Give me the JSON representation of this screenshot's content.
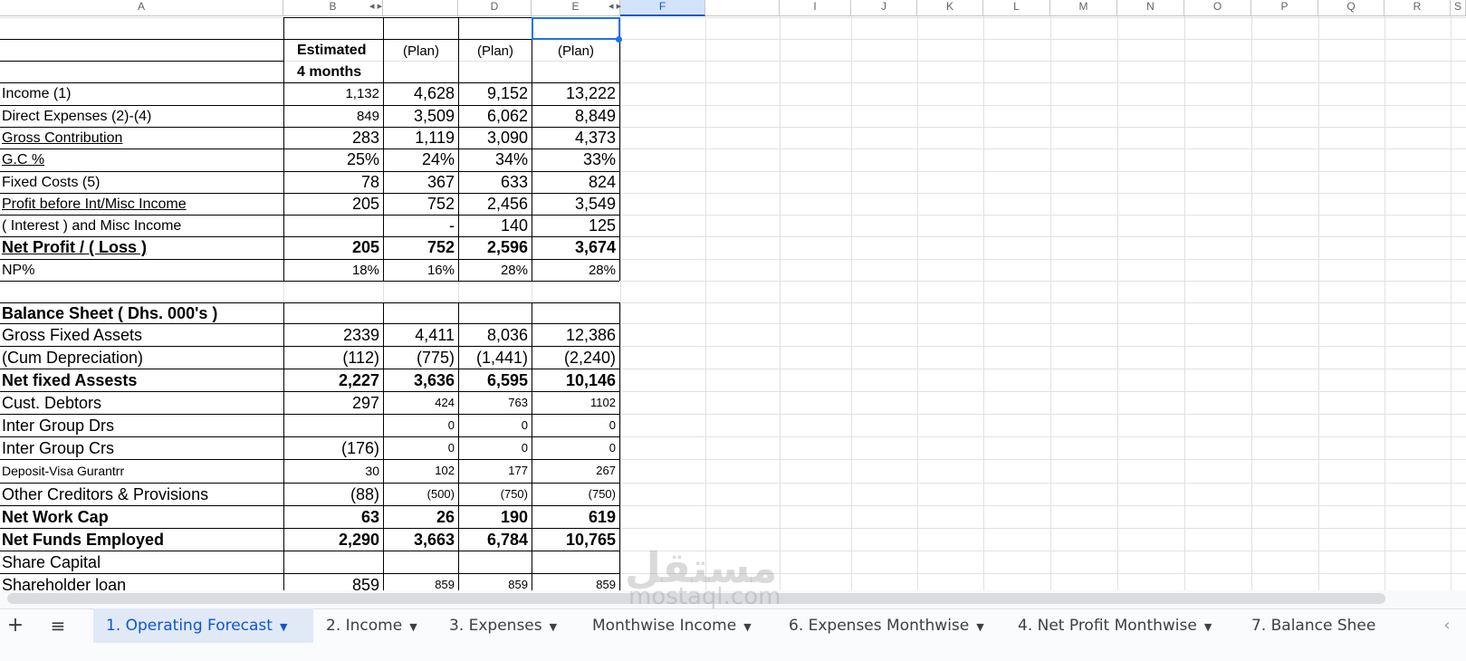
{
  "columns": [
    "A",
    "B",
    "",
    "D",
    "E",
    "F",
    "",
    "I",
    "J",
    "K",
    "L",
    "M",
    "N",
    "O",
    "P",
    "Q",
    "R",
    "S",
    ""
  ],
  "header_row": {
    "b1": "Estimated",
    "b2": "4 months",
    "d": "(Plan)",
    "e": "(Plan)",
    "f": "(Plan)"
  },
  "pl": [
    {
      "label": "Income (1)",
      "b": "1,132",
      "d": "4,628",
      "e": "9,152",
      "f": "13,222"
    },
    {
      "label": "Direct Expenses (2)-(4)",
      "b": "849",
      "d": "3,509",
      "e": "6,062",
      "f": "8,849"
    },
    {
      "label": "Gross Contribution",
      "b": "283",
      "d": "1,119",
      "e": "3,090",
      "f": "4,373"
    },
    {
      "label": "G.C %",
      "b": "25%",
      "d": "24%",
      "e": "34%",
      "f": "33%"
    },
    {
      "label": "Fixed Costs (5)",
      "b": "78",
      "d": "367",
      "e": "633",
      "f": "824"
    },
    {
      "label": "Profit before Int/Misc Income",
      "b": "205",
      "d": "752",
      "e": "2,456",
      "f": "3,549"
    },
    {
      "label": "( Interest ) and Misc Income",
      "b": "",
      "d": "-",
      "e": "140",
      "f": "125"
    },
    {
      "label": "Net Profit / ( Loss )",
      "b": "205",
      "d": "752",
      "e": "2,596",
      "f": "3,674"
    },
    {
      "label": "NP%",
      "b": "18%",
      "d": "16%",
      "e": "28%",
      "f": "28%"
    }
  ],
  "bs_title": "Balance Sheet ( Dhs. 000's )",
  "bs": [
    {
      "label": "Gross Fixed Assets",
      "b": "2339",
      "d": "4,411",
      "e": "8,036",
      "f": "12,386"
    },
    {
      "label": "(Cum Depreciation)",
      "b": "(112)",
      "d": "(775)",
      "e": "(1,441)",
      "f": "(2,240)"
    },
    {
      "label": "Net fixed Assests",
      "b": "2,227",
      "d": "3,636",
      "e": "6,595",
      "f": "10,146"
    },
    {
      "label": "Cust. Debtors",
      "b": "297",
      "d": "424",
      "e": "763",
      "f": "1102"
    },
    {
      "label": "Inter Group Drs",
      "b": "",
      "d": "0",
      "e": "0",
      "f": "0"
    },
    {
      "label": "Inter Group Crs",
      "b": "(176)",
      "d": "0",
      "e": "0",
      "f": "0"
    },
    {
      "label": "Deposit-Visa Gurantrr",
      "b": "30",
      "d": "102",
      "e": "177",
      "f": "267"
    },
    {
      "label": "Other Creditors & Provisions",
      "b": "(88)",
      "d": "(500)",
      "e": "(750)",
      "f": "(750)"
    },
    {
      "label": "Net Work Cap",
      "b": "63",
      "d": "26",
      "e": "190",
      "f": "619"
    },
    {
      "label": "Net Funds Employed",
      "b": "2,290",
      "d": "3,663",
      "e": "6,784",
      "f": "10,765"
    },
    {
      "label": "Share Capital",
      "b": "",
      "d": "",
      "e": "",
      "f": ""
    },
    {
      "label": "Shareholder loan",
      "b": "859",
      "d": "859",
      "e": "859",
      "f": "859"
    }
  ],
  "tabs": {
    "add": "+",
    "menu": "≡",
    "items": [
      "1. Operating Forecast",
      "2. Income",
      "3. Expenses",
      "Monthwise Income",
      "6. Expenses Monthwise",
      "4. Net Profit Monthwise",
      "7. Balance Shee"
    ]
  },
  "watermark": {
    "arabic": "مستقل",
    "latin": "mostaql.com"
  },
  "icons": {
    "caret": "caret-down-icon",
    "scroll_prev": "chevron-left-icon",
    "group_toggle": "triangle-icon"
  }
}
